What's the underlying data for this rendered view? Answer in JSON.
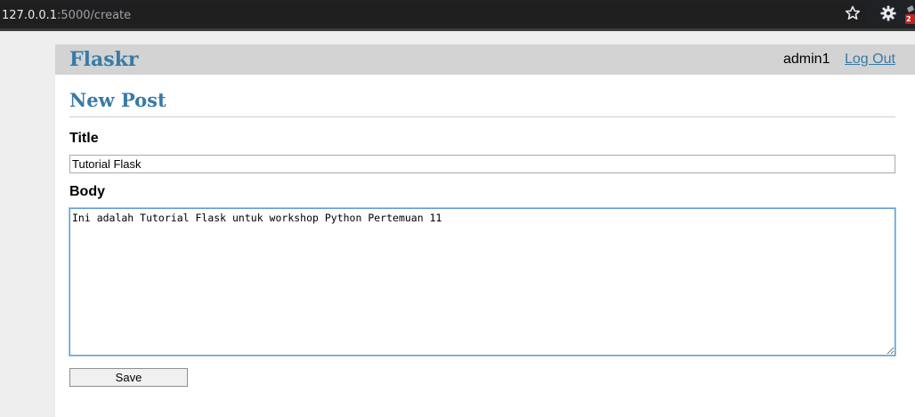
{
  "browser": {
    "url_host": "127.0.0.1",
    "url_path": ":5000/create",
    "extension_badge": "2"
  },
  "nav": {
    "brand": "Flaskr",
    "username": "admin1",
    "logout_label": "Log Out"
  },
  "page": {
    "title": "New Post"
  },
  "form": {
    "title_label": "Title",
    "title_value": "Tutorial Flask",
    "body_label": "Body",
    "body_value": "Ini adalah Tutorial Flask untuk workshop Python Pertemuan 11",
    "save_label": "Save"
  },
  "colors": {
    "accent": "#377ba8",
    "nav_background": "#d3d3d3"
  }
}
